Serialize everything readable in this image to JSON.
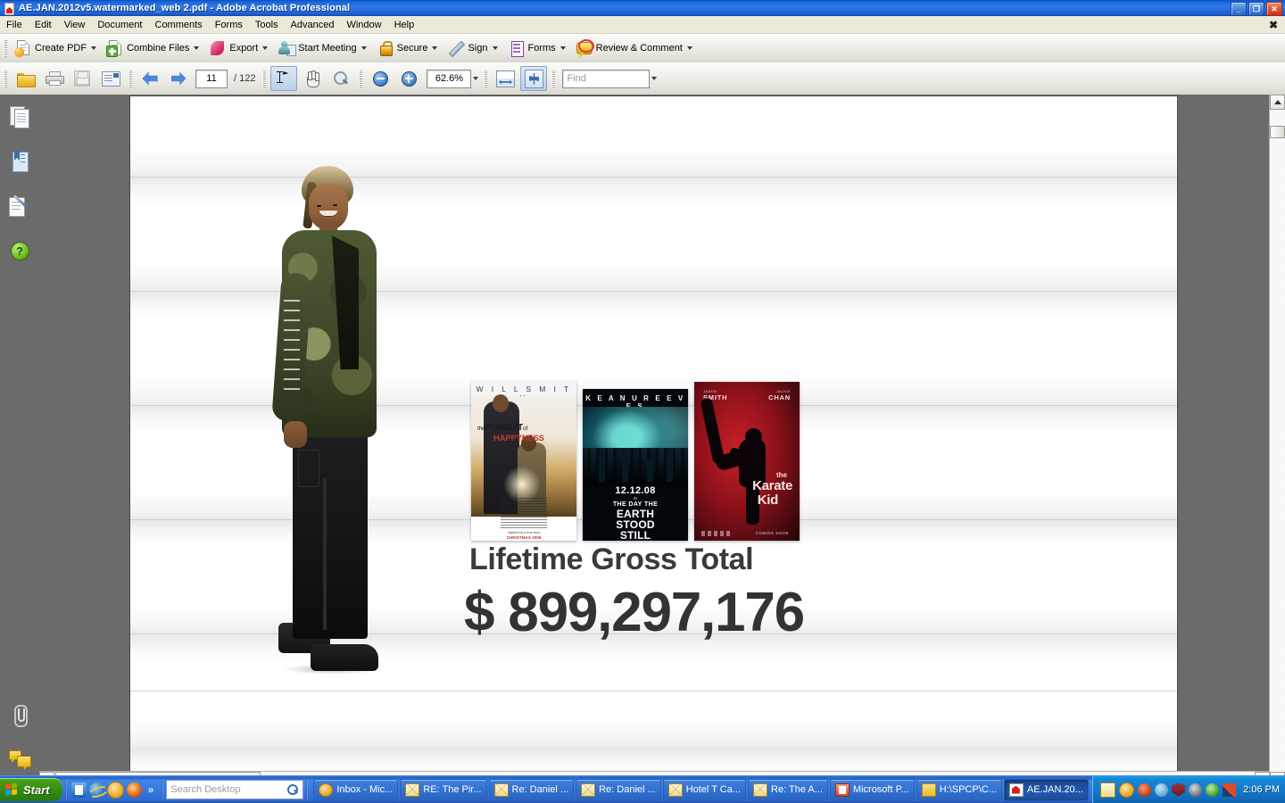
{
  "window": {
    "title": "AE.JAN.2012v5.watermarked_web 2.pdf - Adobe Acrobat Professional",
    "minimize_label": "_",
    "restore_label": "❐",
    "close_label": "✕",
    "menubar_close_label": "✖"
  },
  "menu": {
    "items": [
      {
        "label": "File"
      },
      {
        "label": "Edit"
      },
      {
        "label": "View"
      },
      {
        "label": "Document"
      },
      {
        "label": "Comments"
      },
      {
        "label": "Forms"
      },
      {
        "label": "Tools"
      },
      {
        "label": "Advanced"
      },
      {
        "label": "Window"
      },
      {
        "label": "Help"
      }
    ]
  },
  "toolbar_main": {
    "buttons": [
      {
        "label": "Create PDF",
        "icon": "create-pdf-icon",
        "has_dropdown": true
      },
      {
        "label": "Combine Files",
        "icon": "combine-files-icon",
        "has_dropdown": true
      },
      {
        "label": "Export",
        "icon": "export-icon",
        "has_dropdown": true
      },
      {
        "label": "Start Meeting",
        "icon": "start-meeting-icon",
        "has_dropdown": true
      },
      {
        "label": "Secure",
        "icon": "secure-lock-icon",
        "has_dropdown": true
      },
      {
        "label": "Sign",
        "icon": "sign-pen-icon",
        "has_dropdown": true
      },
      {
        "label": "Forms",
        "icon": "forms-icon",
        "has_dropdown": true
      },
      {
        "label": "Review & Comment",
        "icon": "review-comment-icon",
        "has_dropdown": true
      }
    ]
  },
  "toolbar_nav": {
    "open_icon": "open-folder-icon",
    "print_icon": "print-icon",
    "save_icon": "save-icon",
    "email_icon": "email-icon",
    "prev_page_icon": "arrow-left-icon",
    "next_page_icon": "arrow-right-icon",
    "current_page": "11",
    "page_separator": "/",
    "total_pages": "122",
    "select_tool_icon": "select-text-icon",
    "hand_tool_icon": "hand-tool-icon",
    "marquee_zoom_icon": "marquee-zoom-icon",
    "zoom_out_icon": "zoom-out-icon",
    "zoom_in_icon": "zoom-in-icon",
    "zoom_level": "62.6%",
    "fit_width_icon": "fit-width-icon",
    "fit_page_icon": "fit-page-icon",
    "find_placeholder": "Find"
  },
  "sidebar": {
    "items": [
      {
        "name": "pages-panel",
        "icon": "pages-icon"
      },
      {
        "name": "bookmarks-panel",
        "icon": "bookmarks-icon"
      },
      {
        "name": "signatures-panel",
        "icon": "signatures-icon"
      },
      {
        "name": "help-panel",
        "icon": "help-question-icon"
      }
    ],
    "bottom_items": [
      {
        "name": "attachments-panel",
        "icon": "paperclip-icon"
      },
      {
        "name": "comments-panel",
        "icon": "comments-icon"
      }
    ]
  },
  "document": {
    "headline": "Lifetime Gross Total",
    "amount": "$ 899,297,176",
    "posters": [
      {
        "name": "pursuit-of-happyness-poster",
        "star": "W I L L   S M I T H",
        "title_line1": "the",
        "title_line1b": "PURSUIT",
        "title_line1c": "of",
        "title_line2": "HAPPYNESS",
        "footer_small": "Inspired by a true story",
        "footer_date": "CHRISTMAS 2006"
      },
      {
        "name": "day-the-earth-stood-still-poster",
        "star": "K E A N U   R E E V E S",
        "date": "12.12.08",
        "is": "IS",
        "line1": "THE DAY THE",
        "line2": "EARTH",
        "line3": "STOOD",
        "line4": "STILL"
      },
      {
        "name": "karate-kid-poster",
        "star1_first": "JADEN",
        "star1_last": "SMITH",
        "star2_first": "JACKIE",
        "star2_last": "CHAN",
        "title_line1": "the",
        "title_line2": "Karate",
        "title_line3": "Kid",
        "coming_soon": "COMING SOON"
      }
    ],
    "figure_name": "jaden-smith-cutout"
  },
  "taskbar": {
    "start_label": "Start",
    "quick_launch": [
      {
        "name": "outlook-quicklaunch-icon"
      },
      {
        "name": "internet-explorer-quicklaunch-icon"
      },
      {
        "name": "outlook-express-quicklaunch-icon"
      },
      {
        "name": "firefox-quicklaunch-icon"
      }
    ],
    "expand_label": "»",
    "search_placeholder": "Search Desktop",
    "search_icon": "search-magnifier-icon",
    "tasks": [
      {
        "label": "Inbox - Mic...",
        "icon": "outlook-icon",
        "active": false
      },
      {
        "label": "RE: The Pir...",
        "icon": "mail-icon",
        "active": false
      },
      {
        "label": "Re: Daniel ...",
        "icon": "mail-icon",
        "active": false
      },
      {
        "label": "Re: Daniel ...",
        "icon": "mail-icon",
        "active": false
      },
      {
        "label": "Hotel T Ca...",
        "icon": "mail-icon",
        "active": false
      },
      {
        "label": "Re: The A...",
        "icon": "mail-icon",
        "active": false
      },
      {
        "label": "Microsoft P...",
        "icon": "powerpoint-icon",
        "active": false
      },
      {
        "label": "H:\\SPCP\\C...",
        "icon": "folder-icon",
        "active": false
      },
      {
        "label": "AE.JAN.20...",
        "icon": "acrobat-icon",
        "active": true
      }
    ],
    "tray_icons": [
      {
        "name": "mail-tray-icon"
      },
      {
        "name": "outlook-tray-icon"
      },
      {
        "name": "sync-tray-icon"
      },
      {
        "name": "search-tray-icon"
      },
      {
        "name": "shield-tray-icon"
      },
      {
        "name": "volume-tray-icon"
      },
      {
        "name": "update-tray-icon"
      },
      {
        "name": "network-tray-icon"
      }
    ],
    "clock": "2:06 PM"
  },
  "colors": {
    "title_bar": "#1961d6",
    "menu_bar": "#ece9d8",
    "doc_background": "#6b6b6b",
    "taskbar": "#2a62c8",
    "start_green": "#43a018",
    "headline_gray": "#3a3a3a"
  }
}
